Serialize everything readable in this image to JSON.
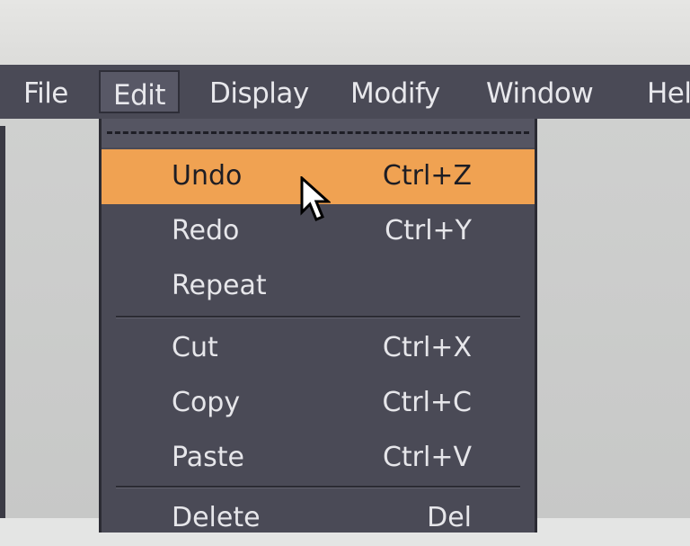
{
  "menubar": {
    "items": [
      {
        "label": "File"
      },
      {
        "label": "Edit",
        "active": true
      },
      {
        "label": "Display"
      },
      {
        "label": "Modify"
      },
      {
        "label": "Window"
      },
      {
        "label": "Help"
      }
    ]
  },
  "edit_menu": {
    "items": [
      {
        "label": "Undo",
        "shortcut": "Ctrl+Z",
        "highlighted": true
      },
      {
        "label": "Redo",
        "shortcut": "Ctrl+Y"
      },
      {
        "label": "Repeat",
        "shortcut": ""
      },
      {
        "label": "Cut",
        "shortcut": "Ctrl+X"
      },
      {
        "label": "Copy",
        "shortcut": "Ctrl+C"
      },
      {
        "label": "Paste",
        "shortcut": "Ctrl+V"
      },
      {
        "label": "Delete",
        "shortcut": "Del"
      }
    ]
  },
  "colors": {
    "menu_background": "#4a4a56",
    "highlight": "#f0a252",
    "menu_text": "#e6e6ea",
    "workspace": "#cbcccb"
  }
}
